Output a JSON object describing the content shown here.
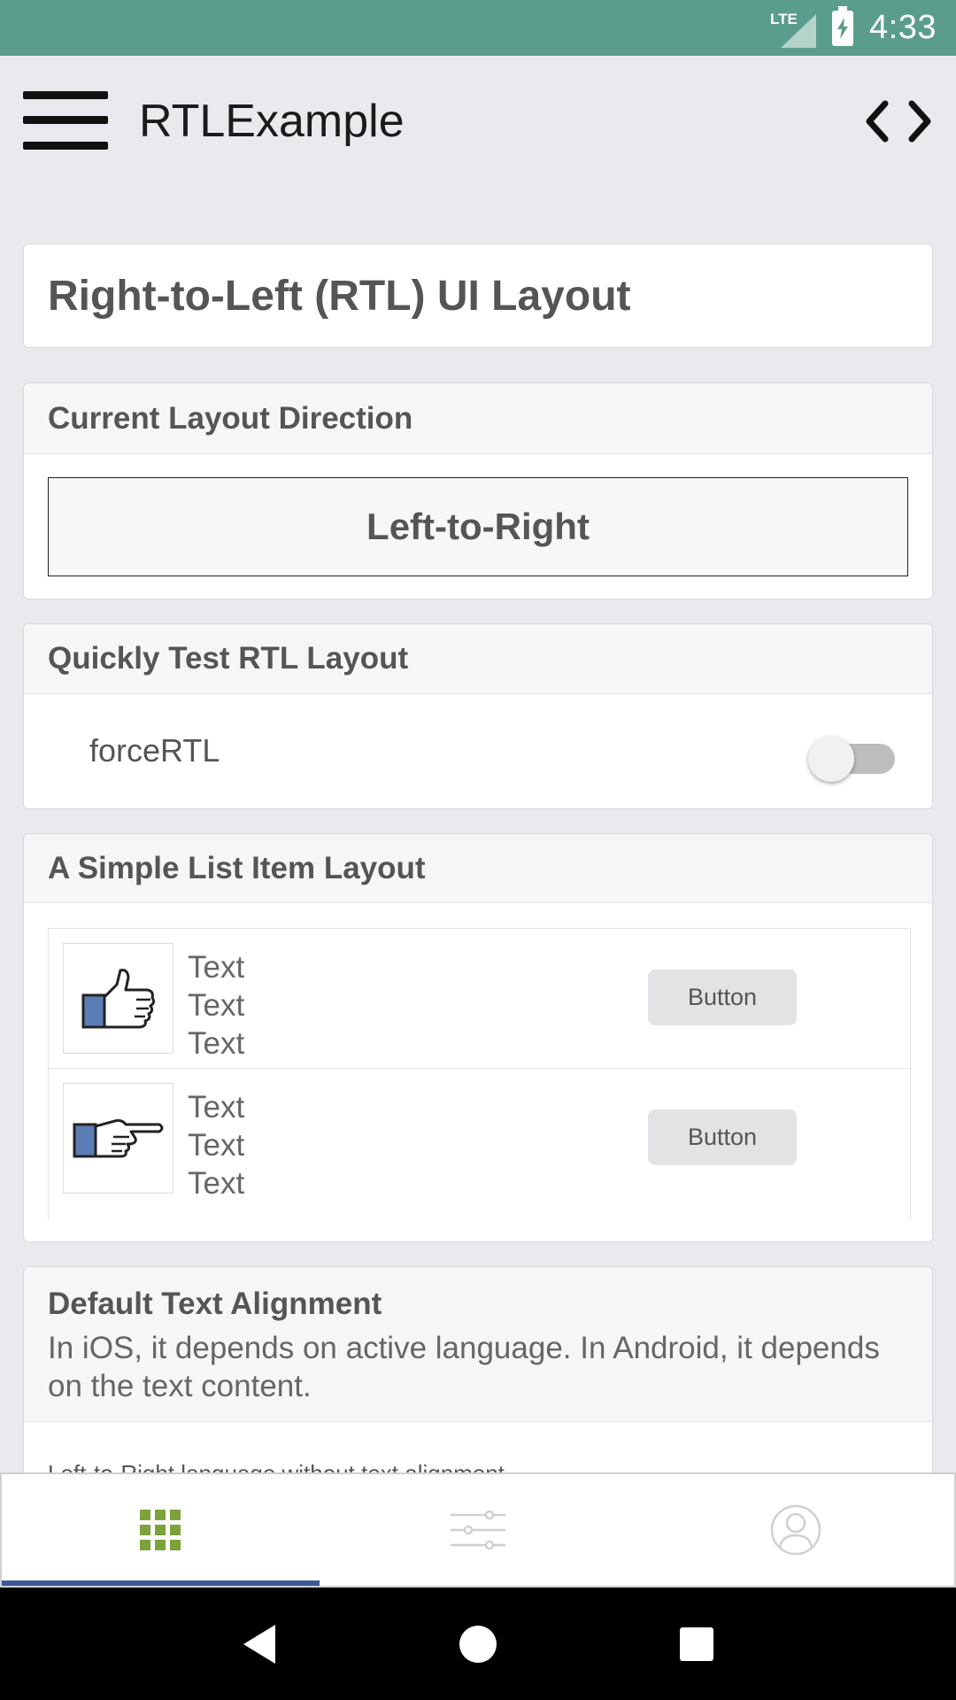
{
  "status_bar": {
    "network": "LTE",
    "time": "4:33"
  },
  "app_bar": {
    "title": "RTLExample",
    "menu_icon": "hamburger-menu-icon",
    "code_icon": "code-brackets-icon"
  },
  "page_title": "Right-to-Left (RTL) UI Layout",
  "direction_section": {
    "header": "Current Layout Direction",
    "value": "Left-to-Right"
  },
  "rtl_test_section": {
    "header": "Quickly Test RTL Layout",
    "toggle_label": "forceRTL",
    "toggle_on": false
  },
  "list_section": {
    "header": "A Simple List Item Layout",
    "items": [
      {
        "icon": "thumbs-up-icon",
        "lines": [
          "Text",
          "Text",
          "Text"
        ],
        "button_label": "Button"
      },
      {
        "icon": "pointing-hand-icon",
        "lines": [
          "Text",
          "Text",
          "Text"
        ],
        "button_label": "Button"
      }
    ]
  },
  "alignment_section": {
    "header": "Default Text Alignment",
    "description": "In iOS, it depends on active language. In Android, it depends on the text content.",
    "body_text": "Left-to-Right language without text alignment."
  },
  "tab_bar": {
    "tabs": [
      {
        "icon": "grid-icon",
        "active": true
      },
      {
        "icon": "sliders-icon",
        "active": false
      },
      {
        "icon": "user-profile-icon",
        "active": false
      }
    ]
  },
  "colors": {
    "status_bar": "#5b9d8d",
    "active_tab_indicator": "#3b5998",
    "active_tab_icon": "#7ca23a",
    "thumb_blue": "#5b7db5"
  }
}
